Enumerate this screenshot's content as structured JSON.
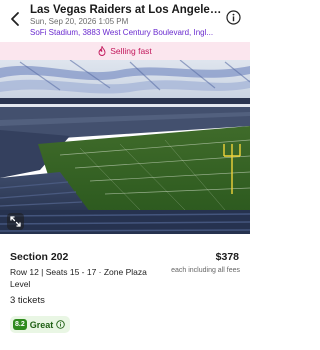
{
  "header": {
    "title": "Las Vegas Raiders at Los Angeles...",
    "date": "Sun, Sep 20, 2026 1:05 PM",
    "venue": "SoFi Stadium, 3883 West Century Boulevard, Ingl..."
  },
  "banner": {
    "text": "Selling fast",
    "color": "#c2185b"
  },
  "listing": {
    "section": "Section 202",
    "price": "$378",
    "row_seats": "Row 12 | Seats 15 - 17 · Zone Plaza Level",
    "price_note": "each including all fees",
    "tickets": "3 tickets",
    "rating_score": "8.2",
    "rating_label": "Great"
  },
  "icons": {
    "back": "chevron-left-icon",
    "info": "info-icon",
    "banner": "flame-icon",
    "expand": "expand-icon",
    "rating_info": "info-icon"
  }
}
